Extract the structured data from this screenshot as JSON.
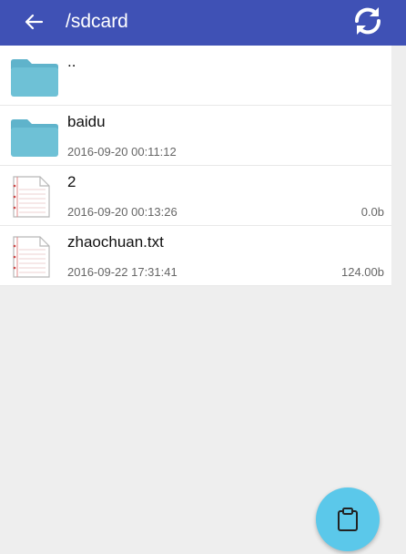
{
  "header": {
    "title": "/sdcard",
    "back_icon": "arrow-left-icon",
    "refresh_icon": "refresh-icon",
    "color": "#3f51b5"
  },
  "files": [
    {
      "name": "..",
      "date": "",
      "size": "",
      "type": "folder",
      "icon": "folder-icon"
    },
    {
      "name": "baidu",
      "date": "2016-09-20 00:11:12",
      "size": "",
      "type": "folder",
      "icon": "folder-icon"
    },
    {
      "name": "2",
      "date": "2016-09-20 00:13:26",
      "size": "0.0b",
      "type": "file",
      "icon": "document-icon"
    },
    {
      "name": "zhaochuan.txt",
      "date": "2016-09-22 17:31:41",
      "size": "124.00b",
      "type": "file",
      "icon": "document-icon"
    }
  ],
  "fab": {
    "icon": "clipboard-icon",
    "color": "#5bc8ea"
  },
  "colors": {
    "folder": "#6ec1d6",
    "background": "#eeeeee"
  }
}
